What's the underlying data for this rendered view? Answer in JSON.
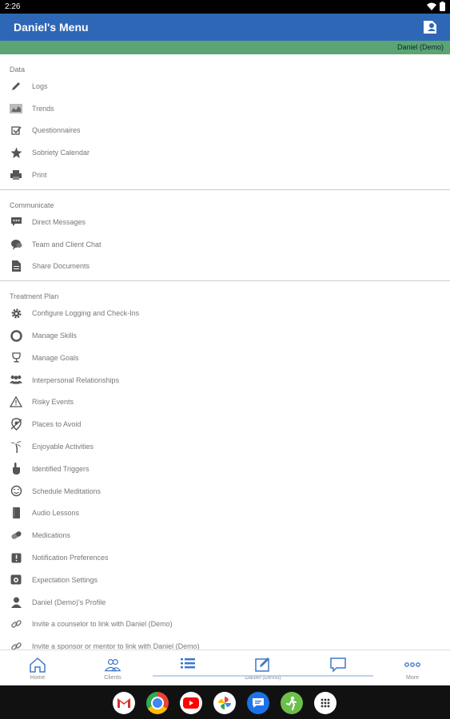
{
  "status_bar": {
    "time": "2:26"
  },
  "app_bar": {
    "title": "Daniel's Menu"
  },
  "user_bar": {
    "name": "Daniel (Demo)"
  },
  "sections": [
    {
      "title": "Data",
      "items": [
        {
          "label": "Logs",
          "icon": "pencil-icon"
        },
        {
          "label": "Trends",
          "icon": "chart-icon"
        },
        {
          "label": "Questionnaires",
          "icon": "checkbox-icon"
        },
        {
          "label": "Sobriety Calendar",
          "icon": "star-icon"
        },
        {
          "label": "Print",
          "icon": "printer-icon"
        }
      ]
    },
    {
      "title": "Communicate",
      "items": [
        {
          "label": "Direct Messages",
          "icon": "message-icon"
        },
        {
          "label": "Team and Client Chat",
          "icon": "chat-icon"
        },
        {
          "label": "Share Documents",
          "icon": "document-icon"
        }
      ]
    },
    {
      "title": "Treatment Plan",
      "items": [
        {
          "label": "Configure Logging and Check-Ins",
          "icon": "gear-icon"
        },
        {
          "label": "Manage Skills",
          "icon": "lifebuoy-icon"
        },
        {
          "label": "Manage Goals",
          "icon": "trophy-icon"
        },
        {
          "label": "Interpersonal Relationships",
          "icon": "people-icon"
        },
        {
          "label": "Risky Events",
          "icon": "warning-icon"
        },
        {
          "label": "Places to Avoid",
          "icon": "no-location-icon"
        },
        {
          "label": "Enjoyable Activities",
          "icon": "palm-tree-icon"
        },
        {
          "label": "Identified Triggers",
          "icon": "pointer-icon"
        },
        {
          "label": "Schedule Meditations",
          "icon": "face-icon"
        },
        {
          "label": "Audio Lessons",
          "icon": "book-icon"
        },
        {
          "label": "Medications",
          "icon": "pill-icon"
        },
        {
          "label": "Notification Preferences",
          "icon": "notification-icon"
        },
        {
          "label": "Expectation Settings",
          "icon": "expectation-icon"
        },
        {
          "label": "Daniel (Demo)'s Profile",
          "icon": "person-icon"
        },
        {
          "label": "Invite a counselor to link with Daniel (Demo)",
          "icon": "link-icon"
        },
        {
          "label": "Invite a sponsor or mentor to link with Daniel (Demo)",
          "icon": "link-icon"
        }
      ]
    }
  ],
  "bottom_nav": [
    {
      "label": "Home",
      "icon": "home-icon"
    },
    {
      "label": "Clients",
      "icon": "clients-icon"
    },
    {
      "label": "",
      "icon": "list-icon"
    },
    {
      "label": "Daniel (Demo)",
      "icon": "edit-icon"
    },
    {
      "label": "",
      "icon": "chat-bubble-icon"
    },
    {
      "label": "More",
      "icon": "more-icon"
    }
  ],
  "dock_apps": [
    "gmail",
    "chrome",
    "youtube",
    "photos",
    "messages",
    "sobriety-app",
    "app-drawer"
  ],
  "colors": {
    "app_bar": "#2f67b7",
    "user_bar": "#5aa573",
    "tab_blue": "#3f78c8"
  }
}
